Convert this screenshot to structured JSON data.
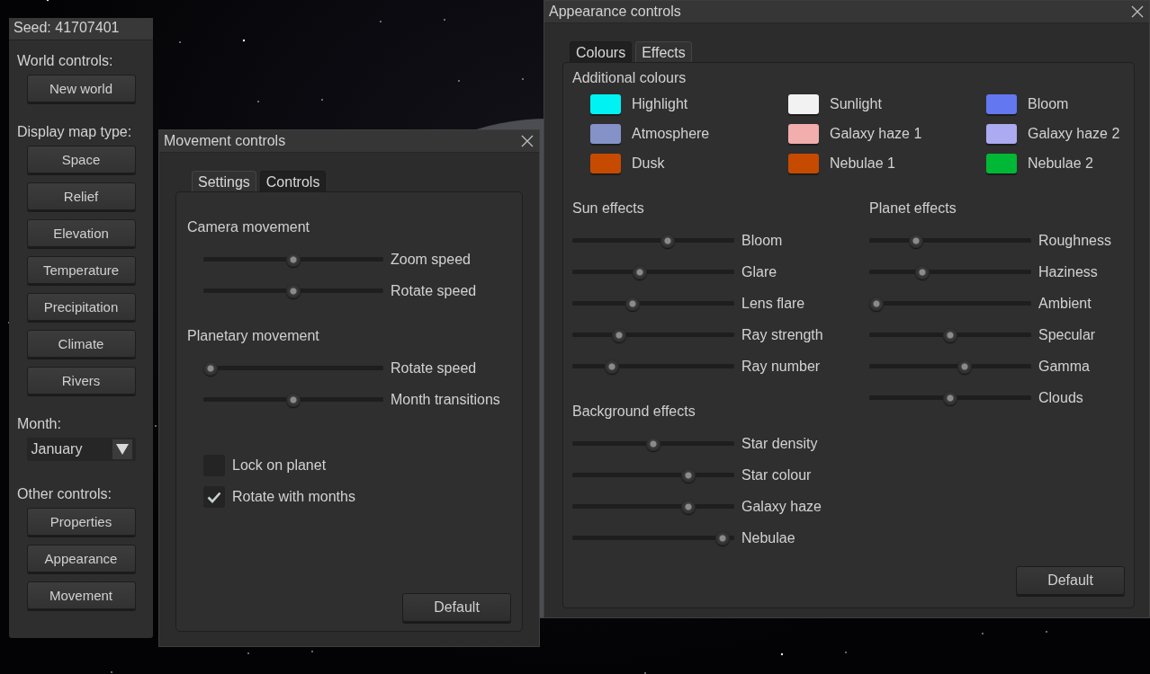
{
  "sidebar": {
    "title": "Seed: 41707401",
    "sections": [
      {
        "kind": "buttons",
        "label": "World controls:",
        "buttons": [
          "New world"
        ]
      },
      {
        "kind": "buttons",
        "label": "Display map type:",
        "buttons": [
          "Space",
          "Relief",
          "Elevation",
          "Temperature",
          "Precipitation",
          "Climate",
          "Rivers"
        ]
      },
      {
        "kind": "dropdown",
        "label": "Month:",
        "value": "January"
      },
      {
        "kind": "buttons",
        "label": "Other controls:",
        "buttons": [
          "Properties",
          "Appearance",
          "Movement"
        ]
      }
    ]
  },
  "movement_window": {
    "title": "Movement controls",
    "tabs": [
      {
        "label": "Settings",
        "selected": true
      },
      {
        "label": "Controls",
        "selected": false
      }
    ],
    "groups": [
      {
        "heading": "Camera movement",
        "sliders": [
          {
            "label": "Zoom speed",
            "level": 0.5
          },
          {
            "label": "Rotate speed",
            "level": 0.5
          }
        ]
      },
      {
        "heading": "Planetary movement",
        "sliders": [
          {
            "label": "Rotate speed",
            "level": 0.0
          },
          {
            "label": "Month transitions",
            "level": 0.5
          }
        ]
      }
    ],
    "checkboxes": [
      {
        "label": "Lock on planet",
        "checked": false
      },
      {
        "label": "Rotate with months",
        "checked": true
      }
    ],
    "button": "Default"
  },
  "appearance_window": {
    "title": "Appearance controls",
    "tabs": [
      {
        "label": "Colours",
        "selected": false
      },
      {
        "label": "Effects",
        "selected": true
      }
    ],
    "colours_heading": "Additional colours",
    "colours": [
      {
        "label": "Highlight",
        "color": "#00f2f2"
      },
      {
        "label": "Sunlight",
        "color": "#f2f2f2"
      },
      {
        "label": "Bloom",
        "color": "#6378f0"
      },
      {
        "label": "Atmosphere",
        "color": "#8592c8"
      },
      {
        "label": "Galaxy haze 1",
        "color": "#f2adad"
      },
      {
        "label": "Galaxy haze 2",
        "color": "#acaaf0"
      },
      {
        "label": "Dusk",
        "color": "#c64a00"
      },
      {
        "label": "Nebulae 1",
        "color": "#c64a00"
      },
      {
        "label": "Nebulae 2",
        "color": "#00b835"
      }
    ],
    "sun_effects": {
      "heading": "Sun effects",
      "sliders": [
        {
          "label": "Bloom",
          "level": 0.6
        },
        {
          "label": "Glare",
          "level": 0.41
        },
        {
          "label": "Lens flare",
          "level": 0.36
        },
        {
          "label": "Ray strength",
          "level": 0.27
        },
        {
          "label": "Ray number",
          "level": 0.22
        }
      ]
    },
    "planet_effects": {
      "heading": "Planet effects",
      "sliders": [
        {
          "label": "Roughness",
          "level": 0.27
        },
        {
          "label": "Haziness",
          "level": 0.31
        },
        {
          "label": "Ambient",
          "level": 0.0
        },
        {
          "label": "Specular",
          "level": 0.5
        },
        {
          "label": "Gamma",
          "level": 0.6
        },
        {
          "label": "Clouds",
          "level": 0.5
        }
      ]
    },
    "background_effects": {
      "heading": "Background effects",
      "sliders": [
        {
          "label": "Star density",
          "level": 0.5
        },
        {
          "label": "Star colour",
          "level": 0.74
        },
        {
          "label": "Galaxy haze",
          "level": 0.74
        },
        {
          "label": "Nebulae",
          "level": 0.97
        }
      ]
    },
    "button": "Default"
  }
}
